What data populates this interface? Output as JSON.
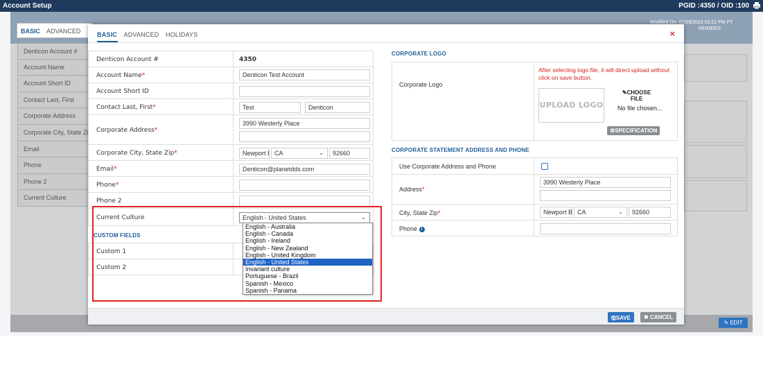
{
  "window": {
    "title": "Account Setup",
    "pgid": "PGID :4350 / OID :100"
  },
  "background": {
    "tabs": [
      "BASIC",
      "ADVANCED"
    ],
    "list": [
      "Denticon Account #",
      "Account Name",
      "Account Short ID",
      "Contact Last, First",
      "Corporate Address",
      "Corporate City, State Zi",
      "Email",
      "Phone",
      "Phone 2",
      "Current Culture"
    ],
    "modified_line1": "Modified On: 07/28/2023 03:21 PM PT",
    "modified_line2": "REIMERS",
    "edit_label": "EDIT"
  },
  "modal": {
    "close": "×",
    "tabs": [
      "BASIC",
      "ADVANCED",
      "HOLIDAYS"
    ],
    "fields": {
      "account_number": {
        "label": "Denticon Account #",
        "value": "4350"
      },
      "account_name": {
        "label": "Account Name",
        "value": "Denticon Test Account"
      },
      "short_id": {
        "label": "Account Short ID",
        "value": ""
      },
      "contact": {
        "label": "Contact Last, First",
        "last": "Test",
        "first": "Denticon"
      },
      "address": {
        "label": "Corporate Address",
        "line1": "3990 Westerly Place",
        "line2": ""
      },
      "city_state_zip": {
        "label": "Corporate City, State Zip",
        "city": "Newport Bea",
        "state": "CA",
        "zip": "92660"
      },
      "email": {
        "label": "Email",
        "value": "Denticon@planetdds.com"
      },
      "phone": {
        "label": "Phone",
        "value": ""
      },
      "phone2": {
        "label": "Phone 2",
        "value": ""
      },
      "culture": {
        "label": "Current Culture",
        "value": "English - United States"
      }
    },
    "custom_fields": {
      "title": "CUSTOM FIELDS",
      "items": [
        "Custom 1",
        "Custom 2"
      ]
    },
    "culture_options": [
      "English - Australia",
      "English - Canada",
      "English - Ireland",
      "English - New Zealand",
      "English - United Kingdom",
      "English - United States",
      "Invariant culture",
      "Portuguese - Brazil",
      "Spanish - Mexico",
      "Spanish - Panama"
    ],
    "culture_selected_index": 5,
    "logo": {
      "section_title": "CORPORATE LOGO",
      "label": "Corporate Logo",
      "note": "After selecting logo file, it will direct upload without click on save button.",
      "upload_text": "UPLOAD LOGO",
      "choose_file_line1": "CHOOSE",
      "choose_file_line2": "FILE",
      "no_file": "No file chosen...",
      "spec_button": "SPECIFICATION"
    },
    "statement": {
      "section_title": "CORPORATE STATEMENT ADDRESS AND PHONE",
      "use_corporate": "Use Corporate Address and Phone",
      "address_label": "Address",
      "address_line1": "3990 Westerly Place",
      "address_line2": "",
      "csz_label": "City, State Zip",
      "city": "Newport Bea",
      "state": "CA",
      "zip": "92660",
      "phone_label": "Phone",
      "phone_value": ""
    },
    "save_label": "SAVE",
    "cancel_label": "CANCEL"
  },
  "colors": {
    "header": "#1f3a5c",
    "accent": "#1f5d99",
    "required": "#d62020",
    "highlight": "#e02020"
  }
}
